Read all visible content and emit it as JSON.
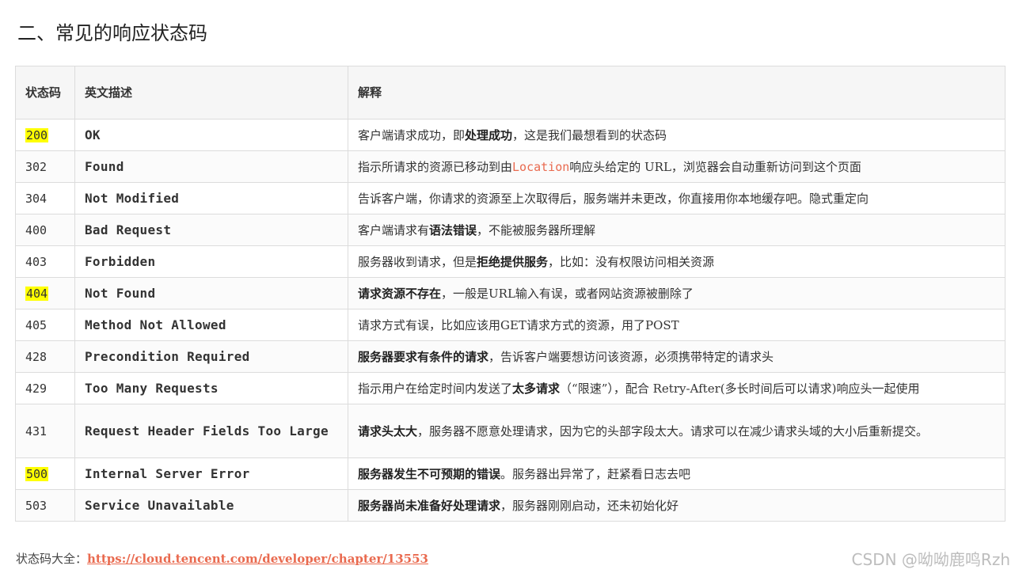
{
  "page": {
    "title": "二、常见的响应状态码"
  },
  "table": {
    "headers": {
      "code": "状态码",
      "desc": "英文描述",
      "expl": "解释"
    },
    "rows": [
      {
        "code": "200",
        "highlight": true,
        "desc": "OK",
        "expl": [
          {
            "t": "客户端请求成功，即"
          },
          {
            "t": "处理成功",
            "b": true
          },
          {
            "t": "，这是我们最想看到的状态码"
          }
        ]
      },
      {
        "code": "302",
        "highlight": false,
        "desc": "Found",
        "expl": [
          {
            "t": "指示所请求的资源已移动到由"
          },
          {
            "t": "Location",
            "c": true
          },
          {
            "t": "响应头给定的 URL，浏览器会自动重新访问到这个页面"
          }
        ]
      },
      {
        "code": "304",
        "highlight": false,
        "desc": "Not Modified",
        "expl": [
          {
            "t": "告诉客户端，你请求的资源至上次取得后，服务端并未更改，你直接用你本地缓存吧。隐式重定向"
          }
        ]
      },
      {
        "code": "400",
        "highlight": false,
        "desc": "Bad Request",
        "expl": [
          {
            "t": "客户端请求有"
          },
          {
            "t": "语法错误",
            "b": true
          },
          {
            "t": "，不能被服务器所理解"
          }
        ]
      },
      {
        "code": "403",
        "highlight": false,
        "desc": "Forbidden",
        "expl": [
          {
            "t": "服务器收到请求，但是"
          },
          {
            "t": "拒绝提供服务",
            "b": true
          },
          {
            "t": "，比如：没有权限访问相关资源"
          }
        ]
      },
      {
        "code": "404",
        "highlight": true,
        "desc": "Not Found",
        "expl": [
          {
            "t": "请求资源不存在",
            "b": true
          },
          {
            "t": "，一般是URL输入有误，或者网站资源被删除了"
          }
        ]
      },
      {
        "code": "405",
        "highlight": false,
        "desc": "Method Not Allowed",
        "expl": [
          {
            "t": "请求方式有误，比如应该用GET请求方式的资源，用了POST"
          }
        ]
      },
      {
        "code": "428",
        "highlight": false,
        "desc": "Precondition Required",
        "expl": [
          {
            "t": "服务器要求有条件的请求",
            "b": true
          },
          {
            "t": "，告诉客户端要想访问该资源，必须携带特定的请求头"
          }
        ]
      },
      {
        "code": "429",
        "highlight": false,
        "desc": "Too Many Requests",
        "expl": [
          {
            "t": "指示用户在给定时间内发送了"
          },
          {
            "t": "太多请求",
            "b": true
          },
          {
            "t": "（“限速”），配合 Retry-After(多长时间后可以请求)响应头一起使用"
          }
        ]
      },
      {
        "code": "431",
        "highlight": false,
        "tall": true,
        "desc": "Request Header Fields Too Large",
        "expl": [
          {
            "t": "请求头太大",
            "b": true
          },
          {
            "t": "，服务器不愿意处理请求，因为它的头部字段太大。请求可以在减少请求头域的大小后重新提交。"
          }
        ]
      },
      {
        "code": "500",
        "highlight": true,
        "desc": "Internal Server Error",
        "expl": [
          {
            "t": "服务器发生不可预期的错误",
            "b": true
          },
          {
            "t": "。服务器出异常了，赶紧看日志去吧"
          }
        ]
      },
      {
        "code": "503",
        "highlight": false,
        "desc": "Service Unavailable",
        "expl": [
          {
            "t": "服务器尚未准备好处理请求",
            "b": true
          },
          {
            "t": "，服务器刚刚启动，还未初始化好"
          }
        ]
      }
    ]
  },
  "footer": {
    "label": "状态码大全：",
    "link": "https://cloud.tencent.com/developer/chapter/13553"
  },
  "watermark": "CSDN @呦呦鹿鸣Rzh",
  "colors": {
    "accent": "#e96a4f",
    "highlight": "#ffff00"
  }
}
